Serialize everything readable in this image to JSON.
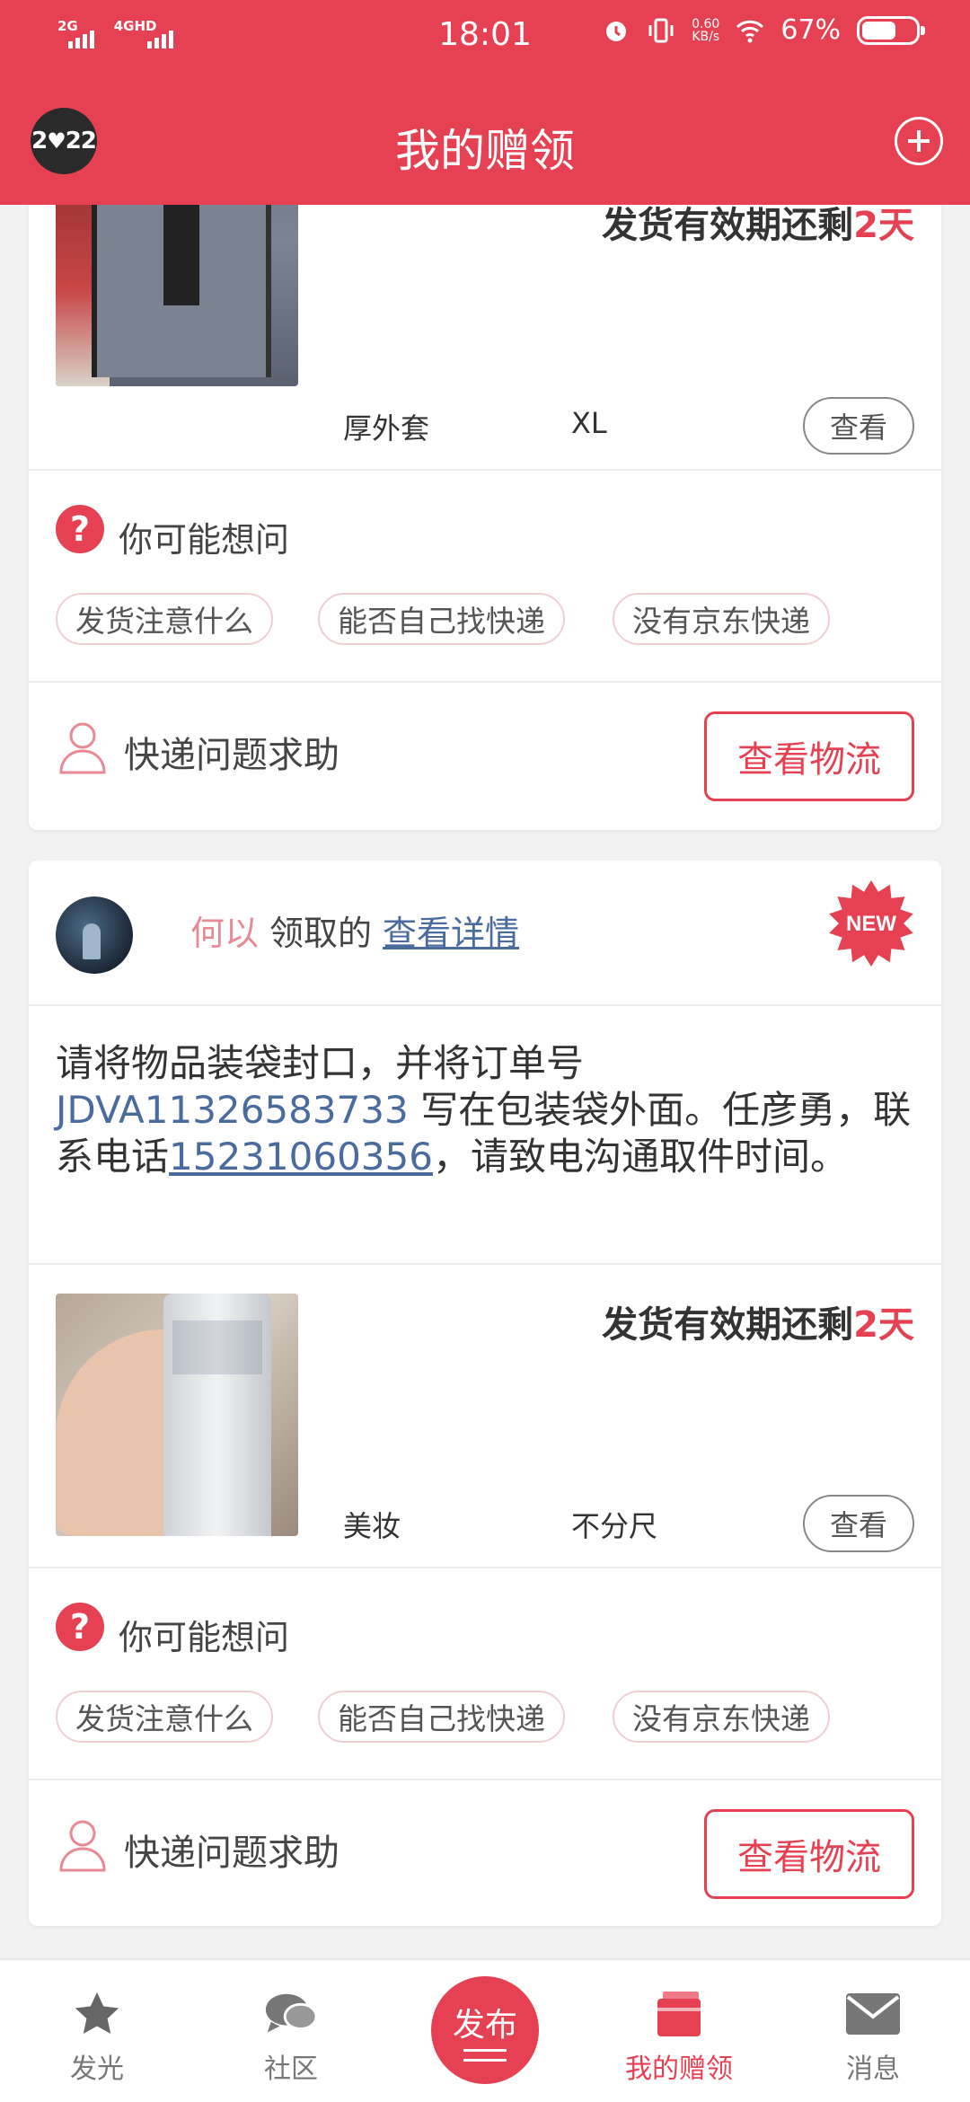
{
  "status_bar": {
    "net1": "2G",
    "net2": "4GHD",
    "time": "18:01",
    "speed_value": "0.60",
    "speed_unit": "KB/s",
    "battery": "67%",
    "battery_level": 0.67
  },
  "nav": {
    "avatar_text_left": "2",
    "avatar_text_right": "22",
    "title": "我的赠领"
  },
  "cards": [
    {
      "validity_prefix": "发货有效期还剩",
      "validity_days": "2天",
      "item_name": "厚外套",
      "item_size": "XL",
      "view_label": "查看",
      "faq_title": "你可能想问",
      "chips": [
        "发货注意什么",
        "能否自己找快递",
        "没有京东快递"
      ],
      "help_text": "快递问题求助",
      "logistics_label": "查看物流"
    },
    {
      "user_name": "何以",
      "received_text": "领取的",
      "detail_link": "查看详情",
      "badge": "NEW",
      "notice_before": "请将物品装袋封口，并将订单号 ",
      "order_code": "JDVA11326583733",
      "notice_middle": " 写在包装袋外面。任彦勇，联系电话",
      "phone": "15231060356",
      "notice_after": "，请致电沟通取件时间。",
      "validity_prefix": "发货有效期还剩",
      "validity_days": "2天",
      "item_name": "美妆",
      "item_size": "不分尺",
      "view_label": "查看",
      "faq_title": "你可能想问",
      "chips": [
        "发货注意什么",
        "能否自己找快递",
        "没有京东快递"
      ],
      "help_text": "快递问题求助",
      "logistics_label": "查看物流"
    }
  ],
  "tabbar": {
    "tabs": [
      {
        "label": "发光",
        "icon": "star-icon"
      },
      {
        "label": "社区",
        "icon": "chat-icon"
      },
      {
        "label": "发布",
        "icon": "publish-icon"
      },
      {
        "label": "我的赠领",
        "icon": "gift-box-icon",
        "active": true
      },
      {
        "label": "消息",
        "icon": "mail-icon"
      }
    ]
  },
  "colors": {
    "brand": "#e64152",
    "link": "#4a6b9e"
  }
}
